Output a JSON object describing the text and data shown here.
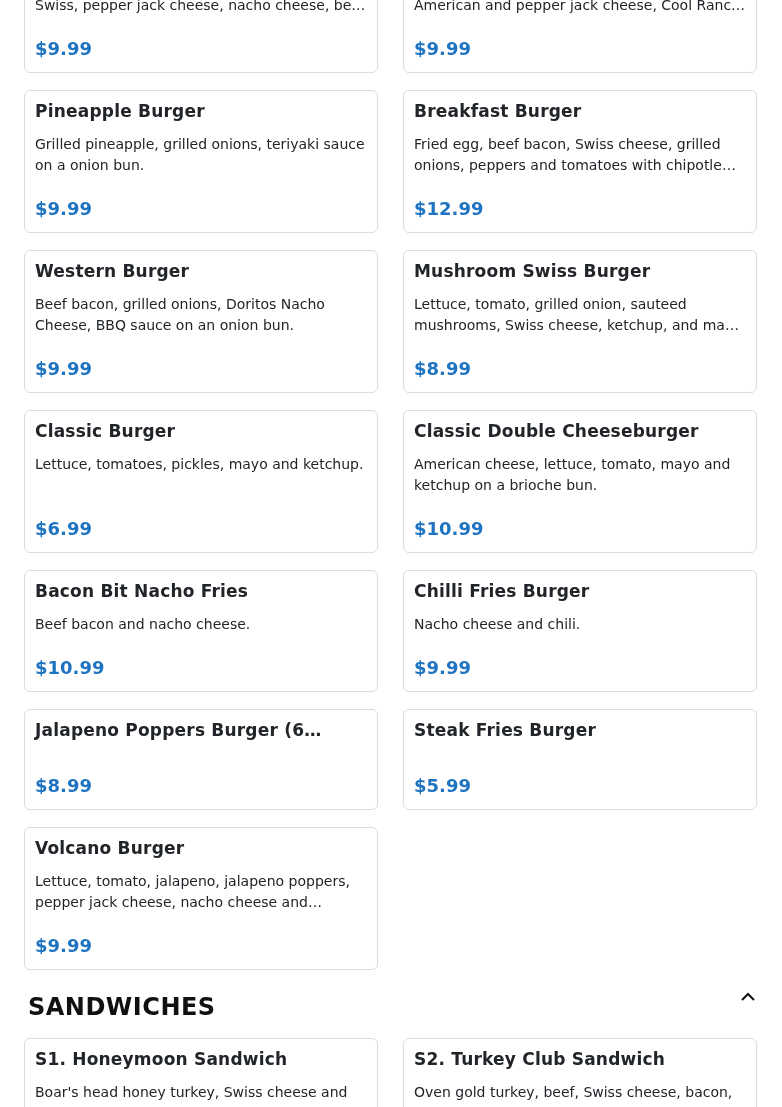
{
  "sections": [
    {
      "items": [
        {
          "description": "Swiss, pepper jack cheese, nacho cheese, be…",
          "price": "$9.99"
        },
        {
          "description": "American and pepper jack cheese, Cool Ranc…",
          "price": "$9.99"
        },
        {
          "name": "Pineapple Burger",
          "description": "Grilled pineapple, grilled onions, teriyaki sauce on a onion bun.",
          "price": "$9.99"
        },
        {
          "name": "Breakfast Burger",
          "description": "Fried egg, beef bacon, Swiss cheese, grilled onions, peppers and tomatoes with chipotle…",
          "price": "$12.99"
        },
        {
          "name": "Western Burger",
          "description": "Beef bacon, grilled onions, Doritos Nacho Cheese, BBQ sauce on an onion bun.",
          "price": "$9.99"
        },
        {
          "name": "Mushroom Swiss Burger",
          "description": "Lettuce, tomato, grilled onion, sauteed mushrooms, Swiss cheese, ketchup, and ma…",
          "price": "$8.99"
        },
        {
          "name": "Classic Burger",
          "description": "Lettuce, tomatoes, pickles, mayo and ketchup.",
          "price": "$6.99"
        },
        {
          "name": "Classic Double Cheeseburger",
          "description": "American cheese, lettuce, tomato, mayo and ketchup on a brioche bun.",
          "price": "$10.99"
        },
        {
          "name": "Bacon Bit Nacho Fries",
          "description": "Beef bacon and nacho cheese.",
          "price": "$10.99"
        },
        {
          "name": "Chilli Fries Burger",
          "description": "Nacho cheese and chili.",
          "price": "$9.99"
        },
        {
          "name": "Jalapeno Poppers Burger (6…",
          "price": "$8.99"
        },
        {
          "name": "Steak Fries Burger",
          "price": "$5.99"
        },
        {
          "name": "Volcano Burger",
          "description": "Lettuce, tomato, jalapeno, jalapeno poppers, pepper jack cheese, nacho cheese and…",
          "price": "$9.99"
        }
      ]
    },
    {
      "title": "SANDWICHES",
      "expanded": true,
      "items": [
        {
          "name": "S1. Honeymoon Sandwich",
          "description": "Boar's head honey turkey, Swiss cheese and"
        },
        {
          "name": "S2. Turkey Club Sandwich",
          "description": "Oven gold turkey, beef, Swiss cheese, bacon,"
        }
      ]
    }
  ]
}
